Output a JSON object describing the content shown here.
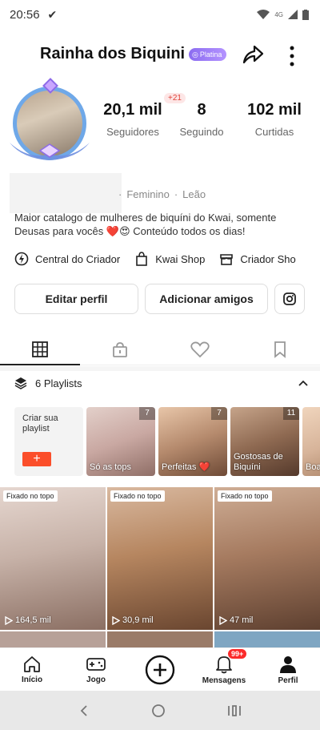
{
  "status_bar": {
    "time": "20:56",
    "network": "4G"
  },
  "header": {
    "title": "Rainha dos Biquini",
    "badge": "Platina"
  },
  "stats": [
    {
      "num": "20,1 mil",
      "label": "Seguidores",
      "badge": "+21"
    },
    {
      "num": "8",
      "label": "Seguindo"
    },
    {
      "num": "102 mil",
      "label": "Curtidas"
    }
  ],
  "profile": {
    "gender": "Feminino",
    "sign": "Leão",
    "bio": "Maior catalogo de mulheres de biquíni do Kwai, somente Deusas  para vocês ❤️😍 Conteúdo todos os dias!"
  },
  "links": [
    {
      "label": "Central do Criador",
      "icon": "bolt-icon"
    },
    {
      "label": "Kwai Shop",
      "icon": "shopping-bag-icon"
    },
    {
      "label": "Criador Sho",
      "icon": "store-icon"
    }
  ],
  "actions": {
    "edit": "Editar perfil",
    "add_friends": "Adicionar amigos"
  },
  "playlists": {
    "header": "6 Playlists",
    "create_label": "Criar sua playlist",
    "items": [
      {
        "name": "Só as tops",
        "count": "7",
        "color": "#c9a8a2"
      },
      {
        "name": "Perfeitas ❤️",
        "count": "7",
        "color": "#b58a6d"
      },
      {
        "name": "Gostosas de Biquíni",
        "count": "11",
        "color": "#8f6a52"
      },
      {
        "name": "Boa tar",
        "count": "",
        "color": "#d7b49a"
      }
    ]
  },
  "videos": [
    {
      "pin": "Fixado no topo",
      "views": "164,5 mil",
      "color": "#c7b2a8"
    },
    {
      "pin": "Fixado no topo",
      "views": "30,9 mil",
      "color": "#b68660"
    },
    {
      "pin": "Fixado no topo",
      "views": "47 mil",
      "color": "#a67b60"
    }
  ],
  "bottom_nav": [
    {
      "label": "Início",
      "icon": "home-icon"
    },
    {
      "label": "Jogo",
      "icon": "gamepad-icon"
    },
    {
      "label": "",
      "icon": "plus-circle-icon"
    },
    {
      "label": "Mensagens",
      "icon": "bell-icon",
      "badge": "99+"
    },
    {
      "label": "Perfil",
      "icon": "person-icon"
    }
  ]
}
